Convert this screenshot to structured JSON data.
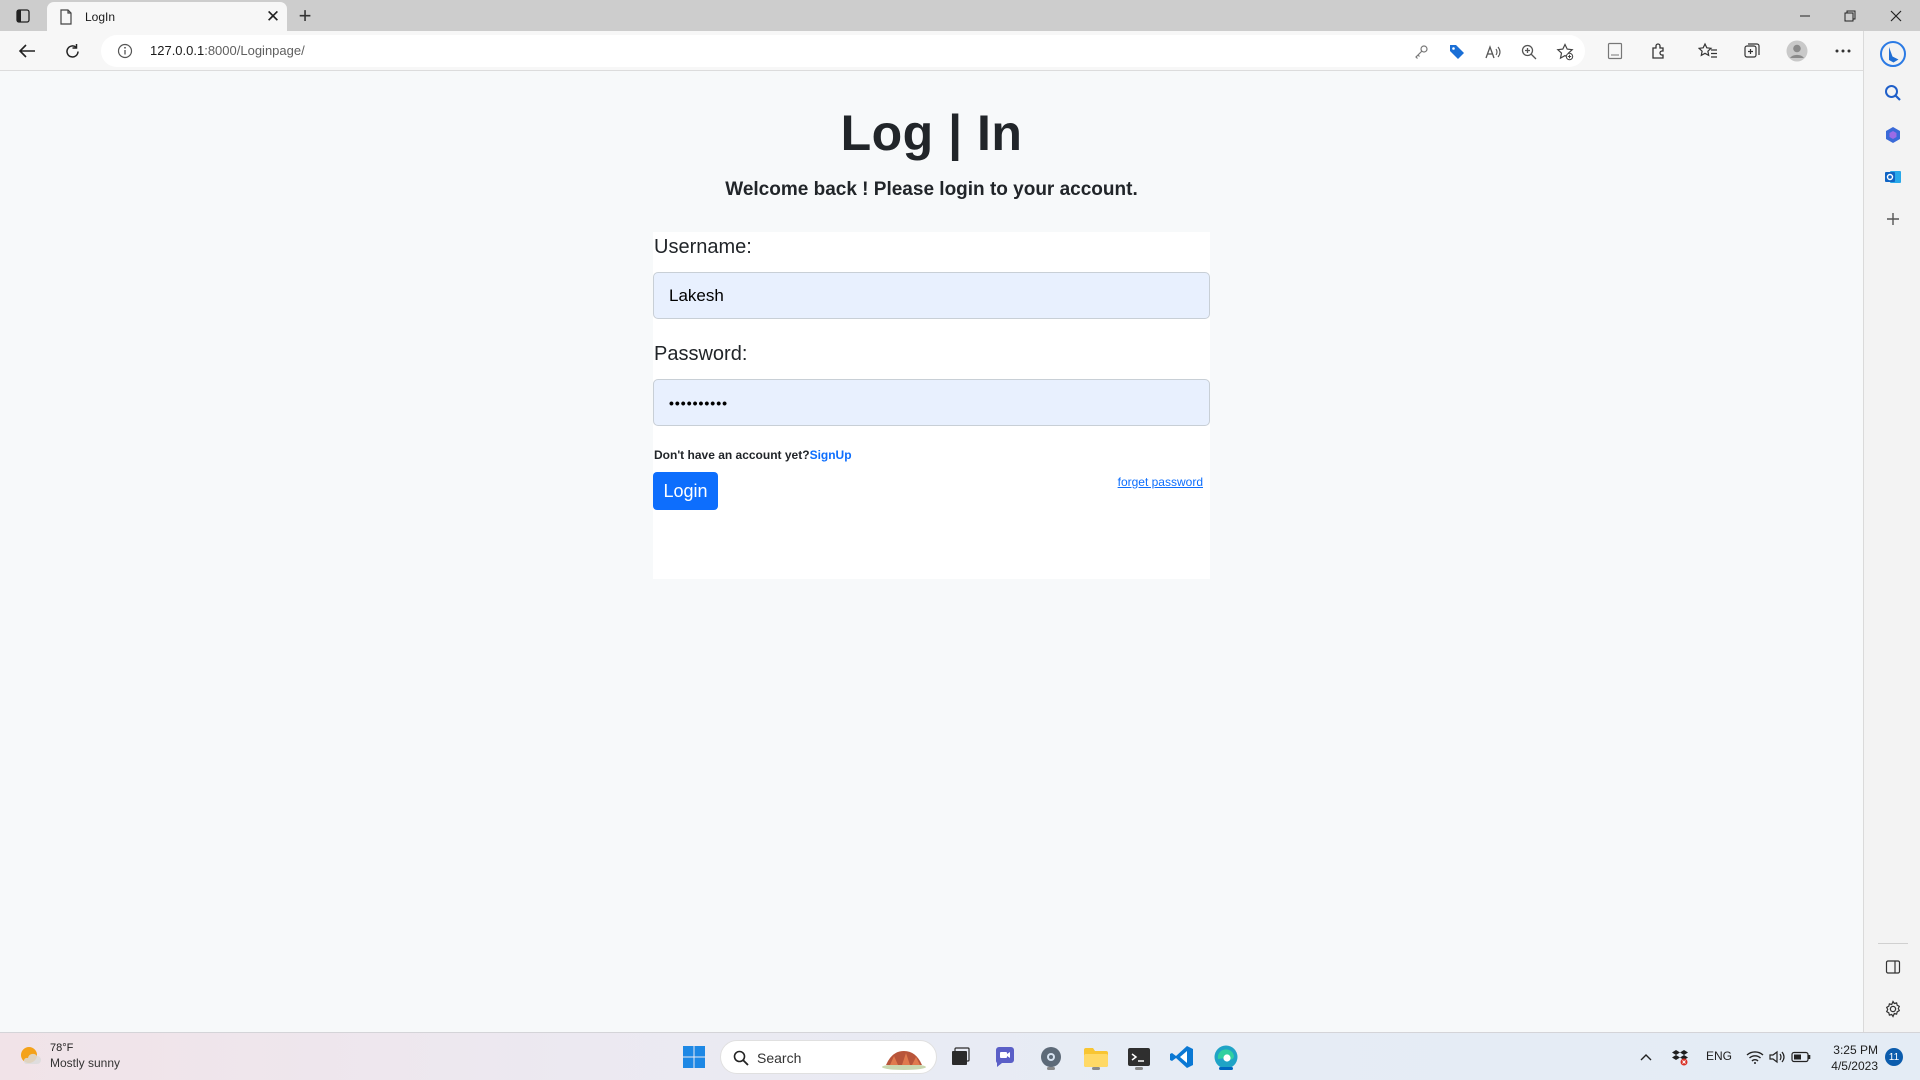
{
  "browser": {
    "tab_title": "LogIn",
    "url_host": "127.0.0.1",
    "url_path": ":8000/Loginpage/"
  },
  "page": {
    "heading": "Log | In",
    "subtitle": "Welcome back ! Please login to your account.",
    "username_label": "Username:",
    "username_value": "Lakesh",
    "password_label": "Password:",
    "password_value": "••••••••••",
    "signup_prompt": "Don't have an account yet?",
    "signup_link": "SignUp",
    "login_button": "Login",
    "forget_password": "forget password"
  },
  "taskbar": {
    "weather_temp": "78°F",
    "weather_condition": "Mostly sunny",
    "search_placeholder": "Search",
    "language": "ENG",
    "time": "3:25 PM",
    "date": "4/5/2023",
    "notification_count": "11"
  },
  "colors": {
    "primary": "#0d6efd",
    "input_background": "#e8f0fe",
    "page_background": "#f7f9fa"
  }
}
